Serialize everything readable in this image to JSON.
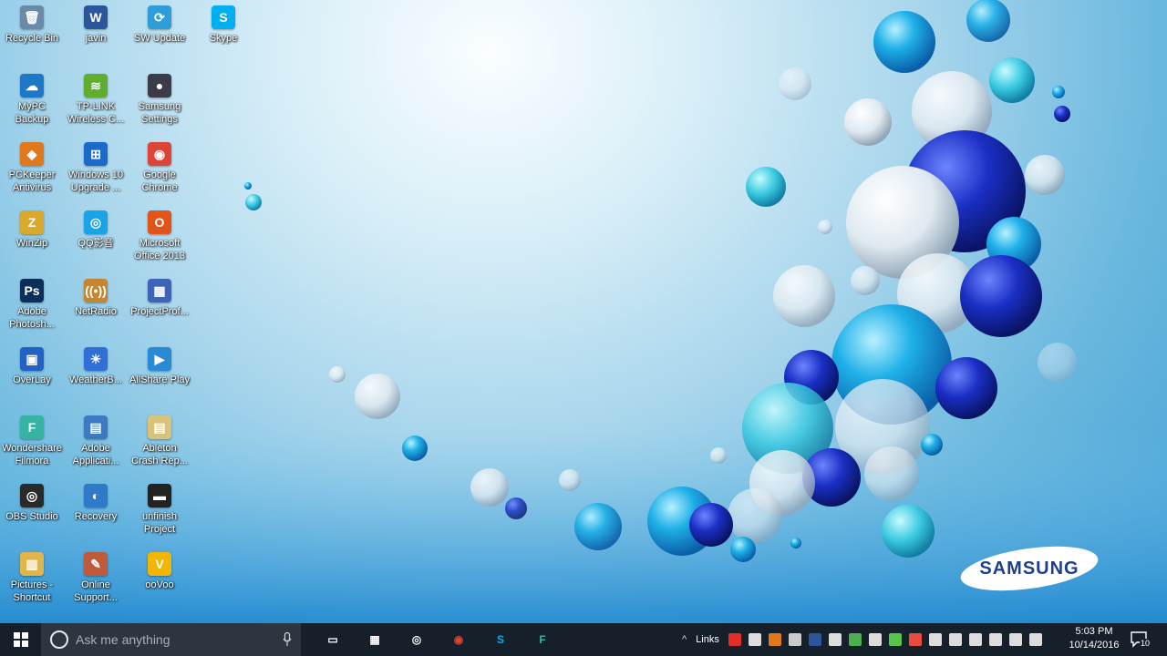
{
  "desktop": {
    "icons": [
      {
        "label": "Recycle Bin",
        "color": "#6a8aa8",
        "glyph": "🗑"
      },
      {
        "label": "javin",
        "color": "#2b579a",
        "glyph": "W"
      },
      {
        "label": "SW Update",
        "color": "#2e9ed8",
        "glyph": "⟳"
      },
      {
        "label": "Skype",
        "color": "#00aff0",
        "glyph": "S"
      },
      {
        "label": "MyPC\nBackup",
        "color": "#1e78c8",
        "glyph": "☁"
      },
      {
        "label": "TP-LINK\nWireless C...",
        "color": "#5fae2e",
        "glyph": "≋"
      },
      {
        "label": "Samsung\nSettings",
        "color": "#3b3b4a",
        "glyph": "●"
      },
      {
        "label": "PCKeeper\nAntivirus",
        "color": "#e2781c",
        "glyph": "◆"
      },
      {
        "label": "Windows 10\nUpgrade ...",
        "color": "#1b6ac9",
        "glyph": "⊞"
      },
      {
        "label": "Google\nChrome",
        "color": "#db4437",
        "glyph": "◉"
      },
      {
        "label": "WinZip",
        "color": "#d8a92a",
        "glyph": "Z"
      },
      {
        "label": "QQ影音",
        "color": "#1aa3e8",
        "glyph": "◎"
      },
      {
        "label": "Microsoft\nOffice 2013",
        "color": "#e3541b",
        "glyph": "O"
      },
      {
        "label": "Adobe\nPhotosh...",
        "color": "#0b2e5a",
        "glyph": "Ps"
      },
      {
        "label": "NetRadio",
        "color": "#c7852e",
        "glyph": "((•))"
      },
      {
        "label": "ProjectProf...",
        "color": "#3f63b8",
        "glyph": "▦"
      },
      {
        "label": "OverLay",
        "color": "#2163c4",
        "glyph": "▣"
      },
      {
        "label": "WeatherB...",
        "color": "#2f6fd6",
        "glyph": "☀"
      },
      {
        "label": "AllShare Play",
        "color": "#2a8ad4",
        "glyph": "▶"
      },
      {
        "label": "Wondershare\nFilmora",
        "color": "#35b3a3",
        "glyph": "F"
      },
      {
        "label": "Adobe\nApplicati...",
        "color": "#3d78c2",
        "glyph": "▤"
      },
      {
        "label": "Ableton\nCrash Rep...",
        "color": "#d9c27a",
        "glyph": "▤"
      },
      {
        "label": "OBS Studio",
        "color": "#2a2a2a",
        "glyph": "◎"
      },
      {
        "label": "Recovery",
        "color": "#2e7ac9",
        "glyph": "◐"
      },
      {
        "label": "unfinish\nProject",
        "color": "#222222",
        "glyph": "▬"
      },
      {
        "label": "Pictures -\nShortcut",
        "color": "#e0b54a",
        "glyph": "▥"
      },
      {
        "label": "Online\nSupport...",
        "color": "#c05a3a",
        "glyph": "✎"
      },
      {
        "label": "ooVoo",
        "color": "#f2b600",
        "glyph": "V"
      }
    ],
    "wallpaper_brand": "SAMSUNG"
  },
  "taskbar": {
    "search_placeholder": "Ask me anything",
    "pinned": [
      {
        "name": "task-view",
        "color": "#ffffff",
        "glyph": "▭"
      },
      {
        "name": "calculator",
        "color": "#ffffff",
        "glyph": "▦"
      },
      {
        "name": "obs-studio",
        "color": "#ffffff",
        "glyph": "◎"
      },
      {
        "name": "google-chrome",
        "color": "#db4437",
        "glyph": "◉"
      },
      {
        "name": "skype",
        "color": "#00aff0",
        "glyph": "S"
      },
      {
        "name": "filmora",
        "color": "#35b3a3",
        "glyph": "F"
      }
    ],
    "tray": {
      "links_label": "Links",
      "up_arrow": "^",
      "icons": [
        {
          "name": "youtube",
          "color": "#e52d27"
        },
        {
          "name": "window",
          "color": "#dddddd"
        },
        {
          "name": "pckeeper",
          "color": "#e2781c"
        },
        {
          "name": "recorder",
          "color": "#cccccc"
        },
        {
          "name": "word",
          "color": "#2b579a"
        },
        {
          "name": "usb",
          "color": "#dddddd"
        },
        {
          "name": "green-app",
          "color": "#4caf50"
        },
        {
          "name": "shield",
          "color": "#dddddd"
        },
        {
          "name": "signal",
          "color": "#57c44a"
        },
        {
          "name": "speaker-mute",
          "color": "#e84c3d"
        },
        {
          "name": "cloud",
          "color": "#dddddd"
        },
        {
          "name": "network",
          "color": "#dddddd"
        },
        {
          "name": "battery",
          "color": "#dddddd"
        },
        {
          "name": "wifi",
          "color": "#dddddd"
        },
        {
          "name": "volume",
          "color": "#dddddd"
        },
        {
          "name": "keyboard",
          "color": "#dddddd"
        }
      ]
    },
    "clock": {
      "time": "5:03 PM",
      "date": "10/14/2016"
    },
    "notifications": {
      "count": "10"
    }
  }
}
